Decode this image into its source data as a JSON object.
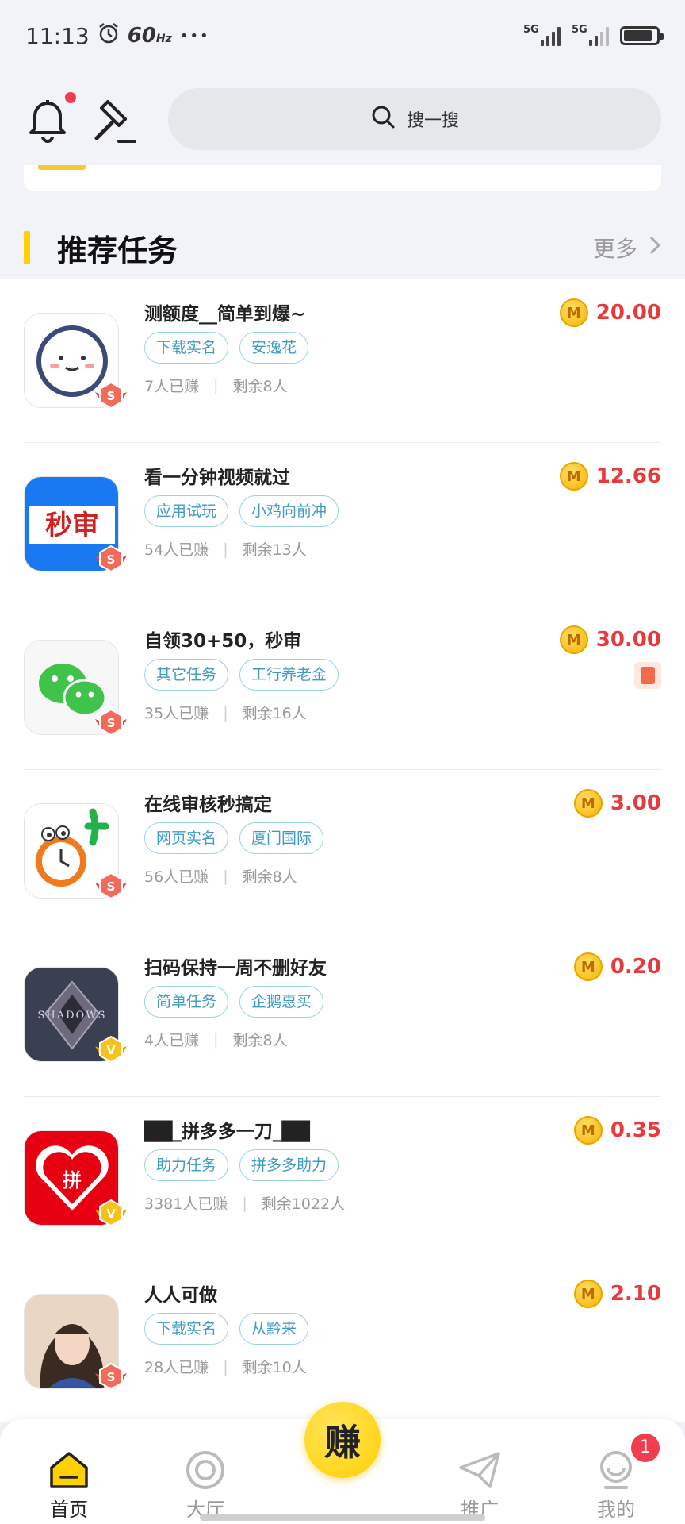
{
  "status_bar": {
    "time": "11:13",
    "refresh": "60",
    "refresh_unit": "Hz",
    "more": "•••",
    "net1": "5G",
    "net2": "5G"
  },
  "header": {
    "search_placeholder": "搜一搜"
  },
  "section": {
    "title": "推荐任务",
    "more_label": "更多"
  },
  "tasks": [
    {
      "name": "测额度__简单到爆~",
      "tags": [
        "下载实名",
        "安逸花"
      ],
      "earned": "7人已赚",
      "left": "剩余8人",
      "price": "20.00",
      "badge": "S",
      "icon": "face-icon",
      "red_packet": false
    },
    {
      "name": "看一分钟视频就过",
      "tags": [
        "应用试玩",
        "小鸡向前冲"
      ],
      "earned": "54人已赚",
      "left": "剩余13人",
      "price": "12.66",
      "badge": "S",
      "icon": "miaoshen-icon",
      "thumb_text": "秒审",
      "red_packet": false
    },
    {
      "name": "自领30+50，秒审",
      "tags": [
        "其它任务",
        "工行养老金"
      ],
      "earned": "35人已赚",
      "left": "剩余16人",
      "price": "30.00",
      "badge": "S",
      "icon": "wechat-icon",
      "red_packet": true
    },
    {
      "name": "在线审核秒搞定",
      "tags": [
        "网页实名",
        "厦门国际"
      ],
      "earned": "56人已赚",
      "left": "剩余8人",
      "price": "3.00",
      "badge": "S",
      "icon": "alarm-clock-icon",
      "red_packet": false
    },
    {
      "name": "扫码保持一周不删好友",
      "tags": [
        "简单任务",
        "企鹅惠买"
      ],
      "earned": "4人已赚",
      "left": "剩余8人",
      "price": "0.20",
      "badge": "V",
      "icon": "shadows-icon",
      "thumb_text": "SHADOWS",
      "red_packet": false
    },
    {
      "name": "██_拼多多一刀_██",
      "tags": [
        "助力任务",
        "拼多多助力"
      ],
      "earned": "3381人已赚",
      "left": "剩余1022人",
      "price": "0.35",
      "badge": "V",
      "icon": "pinduoduo-icon",
      "thumb_text": "拼",
      "red_packet": false
    },
    {
      "name": "人人可做",
      "tags": [
        "下载实名",
        "从黔来"
      ],
      "earned": "28人已赚",
      "left": "剩余10人",
      "price": "2.10",
      "badge": "S",
      "icon": "portrait-icon",
      "red_packet": false
    }
  ],
  "coin_letter": "M",
  "tabbar": {
    "home": "首页",
    "hall": "大厅",
    "earn": "赚",
    "promote": "推广",
    "mine": "我的",
    "mine_badge": "1"
  },
  "colors": {
    "accent": "#ffd000",
    "price": "#e83a3a",
    "tag": "#3f9bc5"
  }
}
